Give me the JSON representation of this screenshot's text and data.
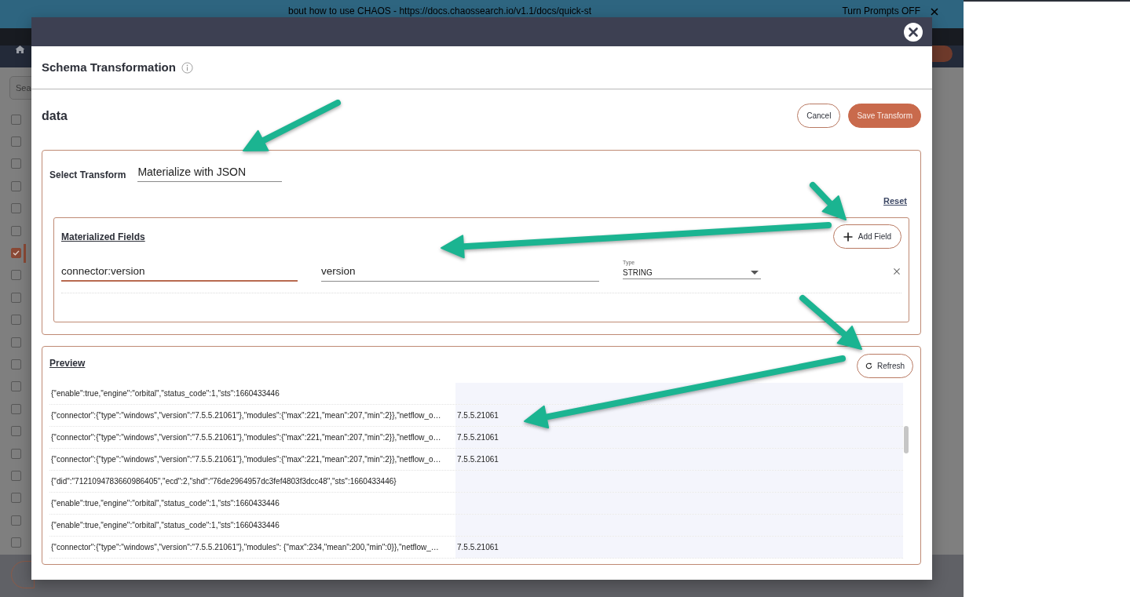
{
  "banner": {
    "message": "bout how to use CHAOS - https://docs.chaossearch.io/v1.1/docs/quick-st",
    "toggle": "Turn Prompts OFF"
  },
  "background": {
    "search_placeholder": "Sea",
    "rows": [
      {
        "checked": false
      },
      {
        "checked": false
      },
      {
        "checked": false
      },
      {
        "checked": false
      },
      {
        "checked": false
      },
      {
        "checked": false
      },
      {
        "checked": true
      },
      {
        "checked": false
      },
      {
        "checked": false
      },
      {
        "checked": false
      },
      {
        "checked": false
      },
      {
        "checked": false
      },
      {
        "checked": false
      },
      {
        "checked": false
      },
      {
        "checked": false
      },
      {
        "checked": false
      },
      {
        "checked": false
      },
      {
        "checked": false
      },
      {
        "checked": false
      },
      {
        "checked": false
      }
    ]
  },
  "modal": {
    "title": "Schema Transformation",
    "dataset": "data",
    "actions": [
      {
        "label": "Cancel",
        "kind": "secondary"
      },
      {
        "label": "Save Transform",
        "kind": "primary"
      }
    ],
    "transform": {
      "label": "Select Transform",
      "value": "Materialize with JSON",
      "reset": "Reset"
    },
    "materialized_fields": {
      "title": "Materialized Fields",
      "add_button": "Add Field",
      "rows": [
        {
          "source": "connector:version",
          "focused": true,
          "name": "version",
          "type_label": "Type",
          "type": "STRING"
        }
      ]
    },
    "preview": {
      "title": "Preview",
      "refresh_button": "Refresh",
      "rows": [
        {
          "json": "{\"enable\":true,\"engine\":\"orbital\",\"status_code\":1,\"sts\":1660433446"
        },
        {
          "json": "{\"connector\":{\"type\":\"windows\",\"version\":\"7.5.5.21061\"},\"modules\":{\"max\":221,\"mean\":207,\"min\":2}},\"netflow_o…",
          "value": "7.5.5.21061"
        },
        {
          "json": "{\"connector\":{\"type\":\"windows\",\"version\":\"7.5.5.21061\"},\"modules\":{\"max\":221,\"mean\":207,\"min\":2}},\"netflow_o…",
          "value": "7.5.5.21061"
        },
        {
          "json": "{\"connector\":{\"type\":\"windows\",\"version\":\"7.5.5.21061\"},\"modules\":{\"max\":221,\"mean\":207,\"min\":2}},\"netflow_o…",
          "value": "7.5.5.21061"
        },
        {
          "json": "{\"did\":\"7121094783660986405\",\"ecd\":2,\"shd\":\"76de2964957dc3fef4803f3dcc48\",\"sts\":1660433446}"
        },
        {
          "json": "{\"enable\":true,\"engine\":\"orbital\",\"status_code\":1,\"sts\":1660433446"
        },
        {
          "json": "{\"enable\":true,\"engine\":\"orbital\",\"status_code\":1,\"sts\":1660433446"
        },
        {
          "json": "{\"connector\":{\"type\":\"windows\",\"version\":\"7.5.5.21061\"},\"modules\": {\"max\":234,\"mean\":200,\"min\":0}},\"netflow_…",
          "value": "7.5.5.21061"
        }
      ]
    }
  }
}
